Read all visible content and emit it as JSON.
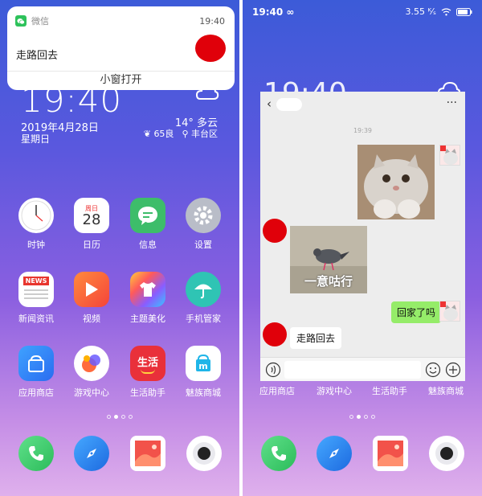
{
  "left": {
    "notification": {
      "app_name": "微信",
      "time": "19:40",
      "message": "走路回去",
      "action": "小窗打开"
    },
    "lock": {
      "clock": "19:40",
      "date": "2019年4月28日",
      "weekday": "星期日",
      "temperature": "14° 多云",
      "air": "65良",
      "location": "丰台区"
    },
    "apps": [
      {
        "label": "时钟",
        "icon": "clock-icon"
      },
      {
        "label": "日历",
        "icon": "calendar-icon",
        "cal_top": "周日",
        "cal_day": "28"
      },
      {
        "label": "信息",
        "icon": "message-icon"
      },
      {
        "label": "设置",
        "icon": "gear-icon"
      },
      {
        "label": "新闻资讯",
        "icon": "news-icon",
        "badge": "NEWS"
      },
      {
        "label": "视频",
        "icon": "video-play-icon"
      },
      {
        "label": "主题美化",
        "icon": "theme-shirt-icon"
      },
      {
        "label": "手机管家",
        "icon": "umbrella-icon"
      },
      {
        "label": "应用商店",
        "icon": "app-store-bag-icon"
      },
      {
        "label": "游戏中心",
        "icon": "game-center-icon"
      },
      {
        "label": "生活助手",
        "icon": "life-assistant-icon",
        "text": "生活"
      },
      {
        "label": "魅族商城",
        "icon": "meizu-store-icon",
        "text": "m"
      }
    ],
    "dock": [
      {
        "icon": "phone-icon"
      },
      {
        "icon": "browser-compass-icon"
      },
      {
        "icon": "gallery-icon"
      },
      {
        "icon": "camera-icon"
      }
    ]
  },
  "right": {
    "status": {
      "time": "19:40",
      "speed": "3.55 ᴷ⁄ₛ"
    },
    "chat": {
      "timestamp": "19:39",
      "sticker_caption": "一意咕行",
      "sent_text": "回家了吗",
      "received_text": "走路回去"
    },
    "bottom_labels": [
      "应用商店",
      "游戏中心",
      "生活助手",
      "魅族商城"
    ]
  },
  "colors": {
    "wechat_green": "#2ec25b",
    "bubble_green": "#95ec69",
    "redaction": "#e0000a"
  }
}
